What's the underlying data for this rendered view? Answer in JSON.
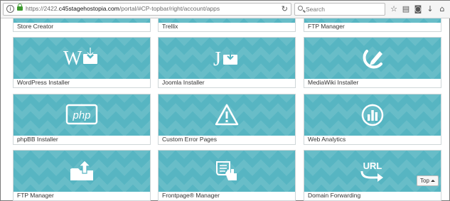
{
  "browser": {
    "url_prefix": "https://2422.",
    "url_host": "c45stagehostopia.com",
    "url_path": "/portal/#CP-topbar/right/account/apps",
    "search_placeholder": "Search"
  },
  "tiles": [
    {
      "label": "Store Creator",
      "icon": "store-icon"
    },
    {
      "label": "Trellix",
      "icon": "trellix-icon"
    },
    {
      "label": "FTP Manager",
      "icon": "ftp-icon"
    },
    {
      "label": "WordPress Installer",
      "icon": "wordpress-icon"
    },
    {
      "label": "Joomla Installer",
      "icon": "joomla-icon"
    },
    {
      "label": "MediaWiki Installer",
      "icon": "mediawiki-icon"
    },
    {
      "label": "phpBB Installer",
      "icon": "phpbb-icon"
    },
    {
      "label": "Custom Error Pages",
      "icon": "warning-icon"
    },
    {
      "label": "Web Analytics",
      "icon": "analytics-icon"
    },
    {
      "label": "FTP Manager",
      "icon": "upload-folder-icon"
    },
    {
      "label": "Frontpage® Manager",
      "icon": "frontpage-icon"
    },
    {
      "label": "Domain Forwarding",
      "icon": "url-forward-icon"
    }
  ],
  "icon_text": {
    "wordpress": "W",
    "joomla": "J",
    "phpbb": "php",
    "url": "URL"
  },
  "top_button": {
    "label": "Top"
  },
  "colors": {
    "tile_bg": "#57b5c2",
    "icon": "#ffffff"
  }
}
